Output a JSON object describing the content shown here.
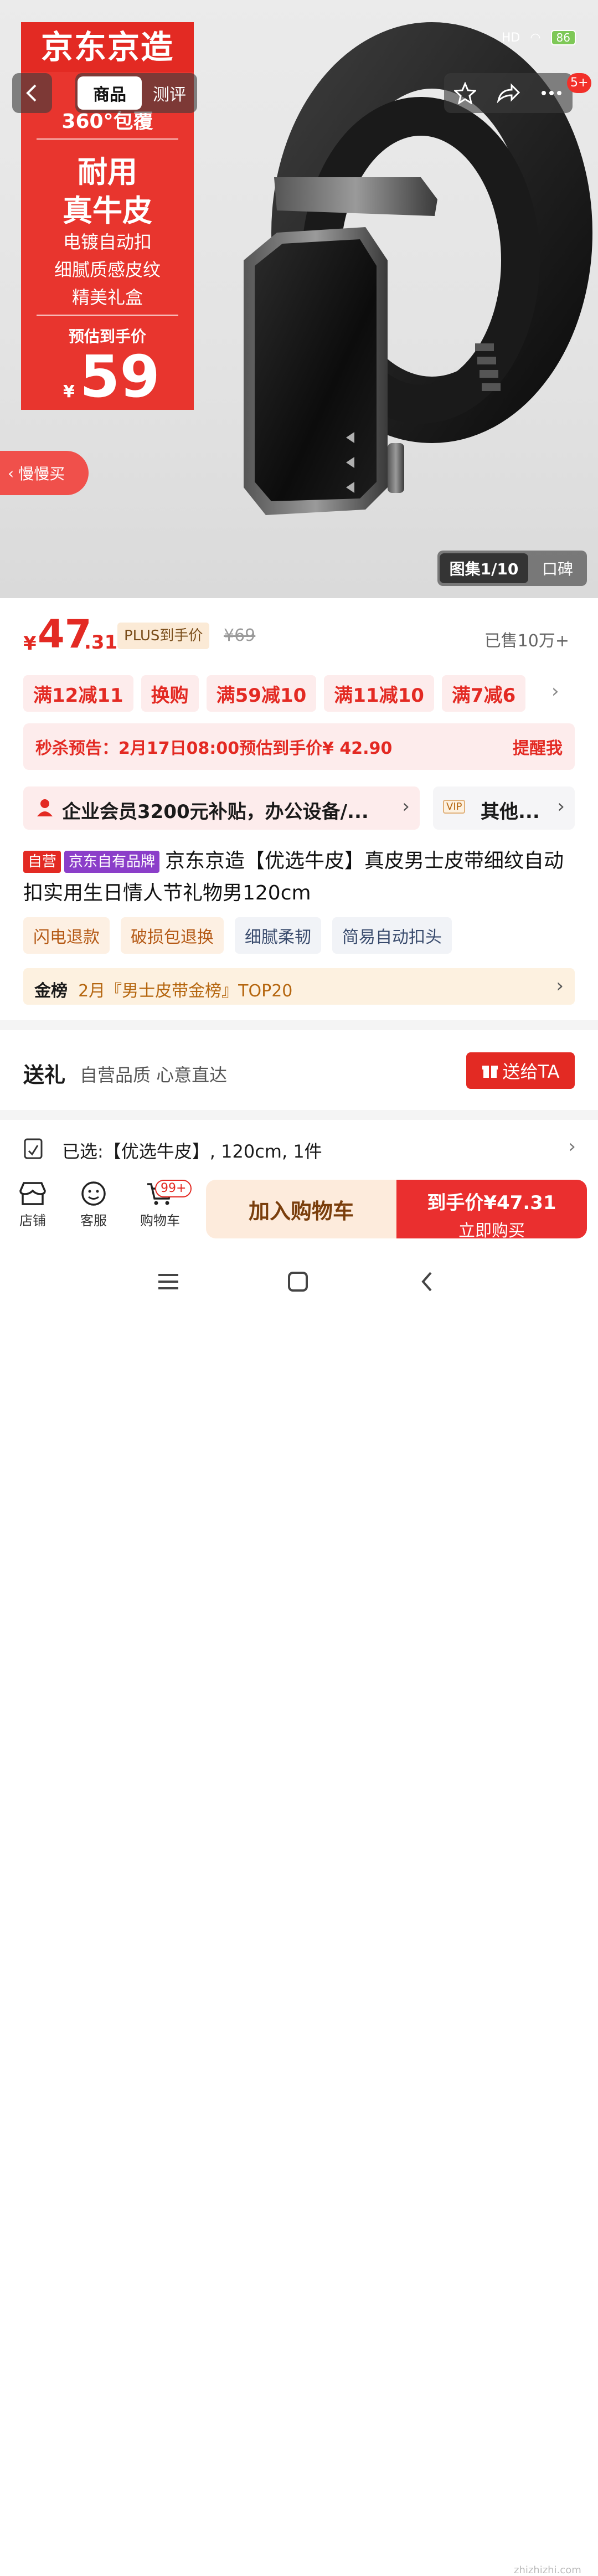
{
  "status": {
    "battery": "86",
    "network": "HD"
  },
  "hero": {
    "brand": "京东京造",
    "banner_lines": [
      "360°包覆",
      "耐用",
      "真牛皮",
      "电镀自动扣",
      "细腻质感皮纹",
      "精美礼盒",
      "预估到手价",
      "¥",
      "59"
    ],
    "tab_active": "商品",
    "tab_inactive": "测评",
    "badge": "5+",
    "slow_buy": "慢慢买",
    "gallery_active": "图集1/10",
    "gallery_inactive": "口碑"
  },
  "price": {
    "symbol": "¥",
    "integer": "47",
    "decimal": ".31",
    "plus_tag": "PLUS到手价",
    "original": "¥69",
    "sold": "已售10万+"
  },
  "promos": [
    "满12减11",
    "换购",
    "满59减10",
    "满11减10",
    "满7减6"
  ],
  "flash": {
    "text": "秒杀预告：2月17日08:00预估到手价¥ 42.90",
    "action": "提醒我"
  },
  "biz": {
    "text": "企业会员3200元补贴，办公设备/...",
    "vip": "VIP",
    "other": "其他..."
  },
  "title": {
    "tag_self": "自营",
    "tag_brand": "京东自有品牌",
    "text": "京东京造【优选牛皮】真皮男士皮带细纹自动扣实用生日情人节礼物男120cm"
  },
  "services": [
    "闪电退款",
    "破损包退换",
    "细腻柔韧",
    "简易自动扣头"
  ],
  "rank": {
    "label": "金榜",
    "text": "2月『男士皮带金榜』TOP20"
  },
  "gift": {
    "heading": "送礼",
    "sub": "自营品质 心意直达",
    "button": "送给TA"
  },
  "selected": {
    "text": "已选:【优选牛皮】, 120cm, 1件"
  },
  "bottom_bar": {
    "store": "店铺",
    "service": "客服",
    "cart": "购物车",
    "cart_badge": "99+",
    "add_to_cart": "加入购物车",
    "buy_price": "到手价¥47.31",
    "buy_now": "立即购买"
  },
  "watermark": "zhizhizhi.com",
  "colors": {
    "accent": "#e32a23",
    "chip_bg": "#fdecec",
    "gold_bg": "#fdf1e0"
  }
}
